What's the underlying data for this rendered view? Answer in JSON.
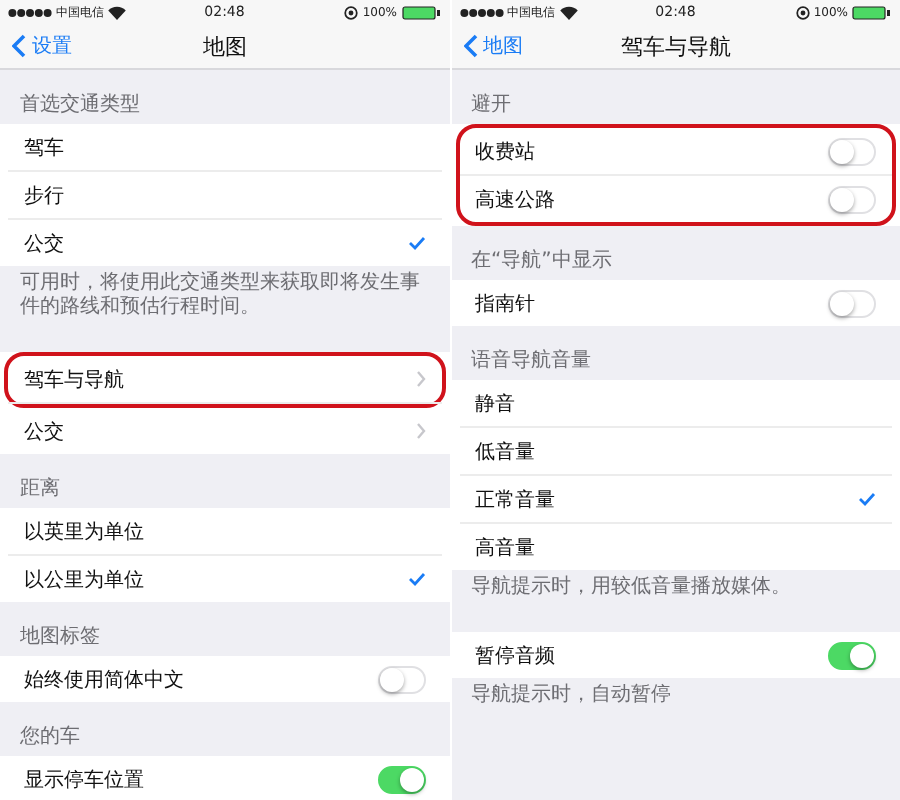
{
  "panels": [
    {
      "status": {
        "carrier": "中国电信",
        "time": "02:48",
        "battery": "100%"
      },
      "nav": {
        "back": "设置",
        "title": "地图"
      },
      "sections": [
        {
          "header": "首选交通类型",
          "rows": [
            {
              "label": "驾车",
              "kind": "check",
              "selected": false,
              "circled": false
            },
            {
              "label": "步行",
              "kind": "check",
              "selected": false,
              "circled": false
            },
            {
              "label": "公交",
              "kind": "check",
              "selected": true,
              "circled": false
            }
          ],
          "footer": "可用时，将使用此交通类型来获取即将发生事件的路线和预估行程时间。"
        },
        {
          "rows": [
            {
              "label": "驾车与导航",
              "kind": "chevron",
              "circled": true
            },
            {
              "label": "公交",
              "kind": "chevron",
              "circled": false
            }
          ]
        },
        {
          "header": "距离",
          "rows": [
            {
              "label": "以英里为单位",
              "kind": "check",
              "selected": false,
              "circled": false
            },
            {
              "label": "以公里为单位",
              "kind": "check",
              "selected": true,
              "circled": false
            }
          ]
        },
        {
          "header": "地图标签",
          "rows": [
            {
              "label": "始终使用简体中文",
              "kind": "toggle",
              "on": false,
              "circled": false
            }
          ]
        },
        {
          "header": "您的车",
          "rows": [
            {
              "label": "显示停车位置",
              "kind": "toggle",
              "on": true,
              "circled": false
            }
          ]
        }
      ]
    },
    {
      "status": {
        "carrier": "中国电信",
        "time": "02:48",
        "battery": "100%"
      },
      "nav": {
        "back": "地图",
        "title": "驾车与导航"
      },
      "sections": [
        {
          "header": "避开",
          "rows": [
            {
              "label": "收费站",
              "kind": "toggle",
              "on": false,
              "circled": true
            },
            {
              "label": "高速公路",
              "kind": "toggle",
              "on": false,
              "circled": true
            }
          ]
        },
        {
          "header": "在“导航”中显示",
          "rows": [
            {
              "label": "指南针",
              "kind": "toggle",
              "on": false,
              "circled": false
            }
          ]
        },
        {
          "header": "语音导航音量",
          "rows": [
            {
              "label": "静音",
              "kind": "check",
              "selected": false,
              "circled": false
            },
            {
              "label": "低音量",
              "kind": "check",
              "selected": false,
              "circled": false
            },
            {
              "label": "正常音量",
              "kind": "check",
              "selected": true,
              "circled": false
            },
            {
              "label": "高音量",
              "kind": "check",
              "selected": false,
              "circled": false
            }
          ],
          "footer": "导航提示时，用较低音量播放媒体。"
        },
        {
          "rows": [
            {
              "label": "暂停音频",
              "kind": "toggle",
              "on": true,
              "circled": false
            }
          ],
          "footer": "导航提示时，自动暂停"
        }
      ]
    }
  ]
}
